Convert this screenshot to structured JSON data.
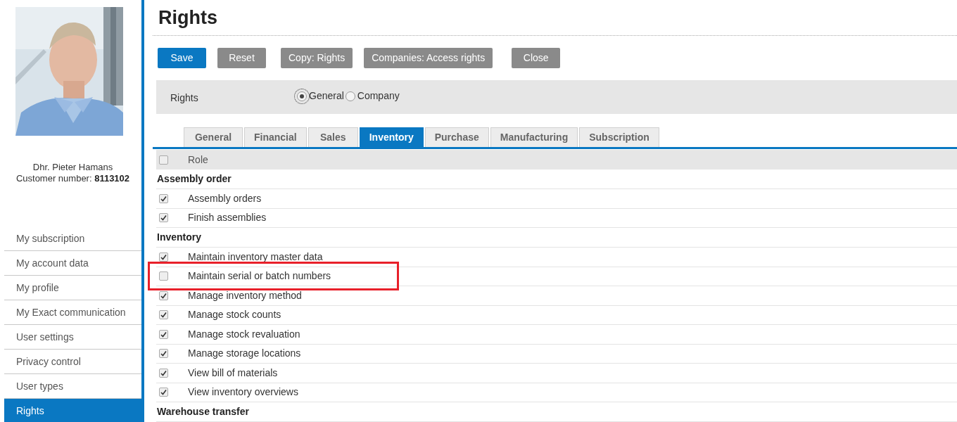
{
  "profile": {
    "name": "Dhr. Pieter Hamans",
    "customer_number_label": "Customer number:",
    "customer_number": "8113102"
  },
  "nav": [
    {
      "label": "My subscription",
      "selected": false
    },
    {
      "label": "My account data",
      "selected": false
    },
    {
      "label": "My profile",
      "selected": false
    },
    {
      "label": "My Exact communication",
      "selected": false
    },
    {
      "label": "User settings",
      "selected": false
    },
    {
      "label": "Privacy control",
      "selected": false
    },
    {
      "label": "User types",
      "selected": false
    },
    {
      "label": "Rights",
      "selected": true
    }
  ],
  "title": "Rights",
  "buttons": [
    {
      "label": "Save",
      "kind": "primary"
    },
    {
      "label": "Reset",
      "kind": "secondary"
    },
    {
      "label": "Copy: Rights",
      "kind": "secondary"
    },
    {
      "label": "Companies: Access rights",
      "kind": "secondary"
    },
    {
      "label": "Close",
      "kind": "secondary"
    }
  ],
  "scope": {
    "label": "Rights",
    "options": [
      {
        "label": "General",
        "selected": true
      },
      {
        "label": "Company",
        "selected": false
      }
    ]
  },
  "tabs": [
    {
      "label": "General",
      "selected": false
    },
    {
      "label": "Financial",
      "selected": false
    },
    {
      "label": "Sales",
      "selected": false
    },
    {
      "label": "Inventory",
      "selected": true
    },
    {
      "label": "Purchase",
      "selected": false
    },
    {
      "label": "Manufacturing",
      "selected": false
    },
    {
      "label": "Subscription",
      "selected": false
    }
  ],
  "table": {
    "header": {
      "label": "Role",
      "checked": false
    },
    "groups": [
      {
        "title": "Assembly order",
        "rows": [
          {
            "label": "Assembly orders",
            "checked": true,
            "highlighted": false
          },
          {
            "label": "Finish assemblies",
            "checked": true,
            "highlighted": false
          }
        ]
      },
      {
        "title": "Inventory",
        "rows": [
          {
            "label": "Maintain inventory master data",
            "checked": true,
            "highlighted": false
          },
          {
            "label": "Maintain serial or batch numbers",
            "checked": false,
            "highlighted": true
          },
          {
            "label": "Manage inventory method",
            "checked": true,
            "highlighted": false
          },
          {
            "label": "Manage stock counts",
            "checked": true,
            "highlighted": false
          },
          {
            "label": "Manage stock revaluation",
            "checked": true,
            "highlighted": false
          },
          {
            "label": "Manage storage locations",
            "checked": true,
            "highlighted": false
          },
          {
            "label": "View bill of materials",
            "checked": true,
            "highlighted": false
          },
          {
            "label": "View inventory overviews",
            "checked": true,
            "highlighted": false
          }
        ]
      },
      {
        "title": "Warehouse transfer"
      }
    ]
  }
}
